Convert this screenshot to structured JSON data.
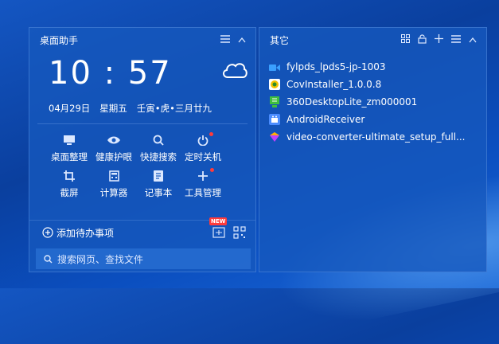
{
  "left_panel": {
    "title": "桌面助手",
    "clock": {
      "time": "10 : 57"
    },
    "date": {
      "day": "04月29日",
      "weekday": "星期五",
      "lunar": "壬寅•虎•三月廿九"
    },
    "tools": [
      {
        "label": "桌面整理",
        "icon": "monitor-icon",
        "dot": false
      },
      {
        "label": "健康护眼",
        "icon": "eye-icon",
        "dot": false
      },
      {
        "label": "快捷搜索",
        "icon": "search-icon",
        "dot": false
      },
      {
        "label": "定时关机",
        "icon": "power-icon",
        "dot": true
      },
      {
        "label": "截屏",
        "icon": "crop-icon",
        "dot": false
      },
      {
        "label": "计算器",
        "icon": "calculator-icon",
        "dot": false
      },
      {
        "label": "记事本",
        "icon": "notepad-icon",
        "dot": false
      },
      {
        "label": "工具管理",
        "icon": "plus-icon",
        "dot": true
      }
    ],
    "todo": {
      "label": "添加待办事项",
      "badge": "NEW"
    },
    "search": {
      "placeholder": "搜索网页、查找文件"
    }
  },
  "right_panel": {
    "title": "其它",
    "files": [
      {
        "name": "fylpds_lpds5-jp-1003",
        "icon": "video-camera-icon",
        "color": "#3aa0ff"
      },
      {
        "name": "CovInstaller_1.0.0.8",
        "icon": "chrome-icon",
        "color": "#f2c200"
      },
      {
        "name": "360DesktopLite_zm000001",
        "icon": "desktop-app-icon",
        "color": "#3fbf3f"
      },
      {
        "name": "AndroidReceiver",
        "icon": "android-receiver-icon",
        "color": "#4a8cff"
      },
      {
        "name": "video-converter-ultimate_setup_full...",
        "icon": "video-converter-icon",
        "color": "#c040ff"
      }
    ]
  },
  "colors": {
    "accent": "#1658be",
    "badge": "#ff3b3b"
  }
}
